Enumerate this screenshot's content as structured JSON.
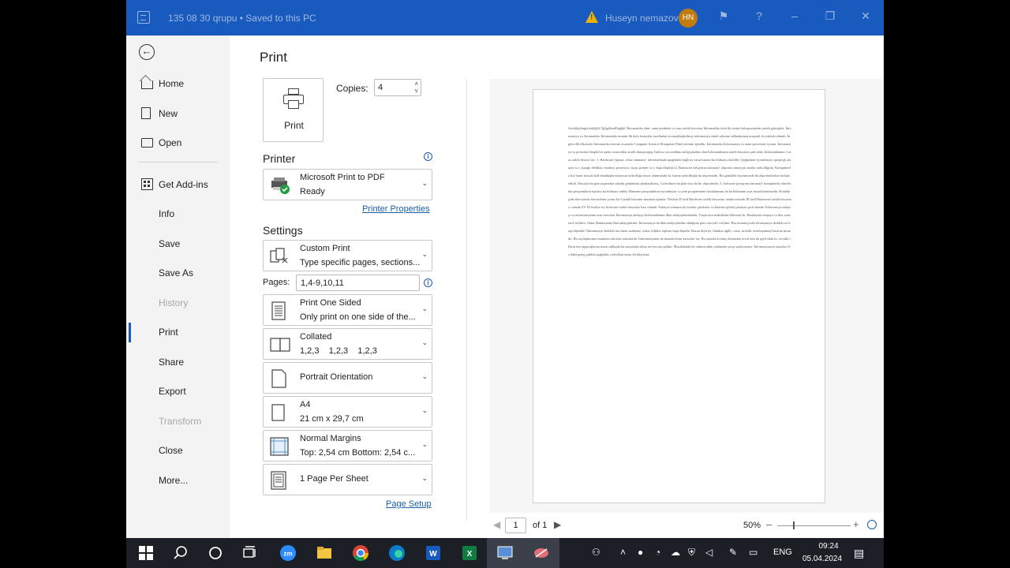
{
  "titlebar": {
    "doc_title": "135 08 30 qrupu  •  Saved to this PC",
    "user_name": "Huseyn nemazov",
    "avatar_initials": "HN",
    "accent": "#185abd"
  },
  "nav": {
    "items": [
      {
        "label": "Home",
        "icon": "home-icon"
      },
      {
        "label": "New",
        "icon": "document-icon"
      },
      {
        "label": "Open",
        "icon": "folder-icon"
      },
      {
        "label": "Get Add-ins",
        "icon": "add-ins-icon"
      },
      {
        "label": "Info"
      },
      {
        "label": "Save"
      },
      {
        "label": "Save As"
      },
      {
        "label": "History",
        "disabled": true
      },
      {
        "label": "Print",
        "selected": true
      },
      {
        "label": "Share"
      },
      {
        "label": "Export"
      },
      {
        "label": "Transform",
        "disabled": true
      },
      {
        "label": "Close"
      },
      {
        "label": "More..."
      }
    ]
  },
  "print": {
    "title": "Print",
    "print_button": "Print",
    "copies_label": "Copies:",
    "copies_value": "4"
  },
  "printer": {
    "section": "Printer",
    "name": "Microsoft Print to PDF",
    "status": "Ready",
    "properties_link": "Printer Properties"
  },
  "settings": {
    "section": "Settings",
    "range": {
      "l1": "Custom Print",
      "l2": "Type specific pages, sections..."
    },
    "pages_label": "Pages:",
    "pages_value": "1,4-9,10,11",
    "sides": {
      "l1": "Print One Sided",
      "l2": "Only print on one side of the..."
    },
    "collation": {
      "l1": "Collated",
      "l2": "1,2,3    1,2,3    1,2,3"
    },
    "orientation": {
      "l1": "Portrait Orientation"
    },
    "paper": {
      "l1": "A4",
      "l2": "21 cm x 29,7 cm"
    },
    "margins": {
      "l1": "Normal Margins",
      "l2": "Top: 2,54 cm Bottom: 2,54 c..."
    },
    "per_sheet": {
      "l1": "1 Page Per Sheet"
    },
    "page_setup_link": "Page Setup"
  },
  "preview": {
    "text": "Grtyhkjyhtrgefwdyhjkl;'/ljjhgfdsadfhghjkl;'İnformatika elmi, onun predmeti və əsas tərkib hissələri İnformatika sözü iki sözün birləşməsindən əmələ gəlmişdir: İnformasiya və Avtomatika. İnformatika termini ilk dəfə fransızlar tərəfindən avtomatlaşdırılmış informasiya emalı sahəsini adlandırmaq məqsədi ilə istifadə olunub. İngilis dili ölkələrdə İnformatika termini əvəzində Computer Science (Kompüter Elmi) termini işlədilir. İnformatika İnformasiya və onun prosesləri öyrənir. İnformasiya və prosesləri haqda bir qədər sonra daha ətraflı danışacağıq. İndi isə çox mühüm anlayışlardan olan İnformatikanın tərkib hissələri şərh edək. İnformatikanın 3 əsas tərkib hissəsi var: 1. Hardware (aparat, cihaz təminatı)- informatikada qurğularla bağlı nə varsa hamısı bu bölməyə daxildir. Qurğuların öyrənilməsi, qarşılıqlı əlaqəsi və s. (qurğu dedikdə: monitor, prosessor, siçan, printer və s. başa düşülür) 2. Brainware (alqoritm təminatı)- alqoritm müəyyən əmrlər ardıcıllığıdır. Kompüterdə hər hansı məsələ həll olunduqda müəyyən ardıcıllığa riayət olunmalıdır ki, həmin ardıcıllıqlar da alqoritmdir. Biz gündəlik həyatımızda da alqoritmlərdən istifadə edirik. Məsələn bu gün axşamdan səhərki günümüzü planlaşdırırıq. Cədvəlimiz bu plan üzrə da bir alqoritmdir. 3. Software (proqram təminatı)- kompüterdə olan bütün proqramların toplusu bu bölməyə aiddir. Hansının proqramların öyrənilməsi və yeni proqramların hazırlanması da bu bölmənin əsas məsələlərindəndir. Kitabda şərh edəcəyimiz mövzuların çoxsu bu 3 tərkib hissənin üzərində qurulur. Növbəti II fəsil Hardware tərkib hissəsinə, ondan sonrakı III fəsil Brainware tərkib hissəsinə, sonrakı IV-XI fəsillər isə Software tərkib hissəsinə həsr olunub. Nəhayət sonuncu iki fəsildə şəbəkələr və İnternet qlobal şəbəkəsi şərh olunub. İnformasiya anlayışı və informasiyanın əsas xassələri İnformasiya anlayışı İnformatikanın ilkin anlayışlarındandır. Yəqin orta məktəbdən bilirsiniz ki, Həndəsədə nöqtəyə və düz xəttə tərif verilmir. Onlar Həndəsənin ilkin anlayışlarıdır. İnformasiya da ilkin anlayışlardan olduğuna görə ona tərif verilmir. Bəs ümumiyyətlə informasiya dedikdə nə başa düşürük? İnformasiya dedikdə hər hansı məlumat, xəbər, biliklər toplusu başa düşülür. Bəzən deyirlər, filankəs ağıllı, cəsur, savadlı, dostluqətmaq bacaran insandır. Bu saydıqlarımız insanlara aid olan xassələrdir. İnformasiyanın da insanlar kimi xassələri var. Bu xassələrlə tanış olmazdan əvvəl onu da qeyd edək ki, əvvəlki illərin test tapşırıqlarına nəzər saldıqda bu xassələrin adına tez-tez rast gəlinir. Məsələhətdir ki onların adını yadınızda yaxşı saxlayasınız. İnformasiyanın xassələri ilə daha geniş şəkildə aşağıdakı cədvəldən tanış ola bilərsiniz",
    "page_current": "1",
    "page_of": "of 1",
    "zoom": "50%"
  },
  "taskbar": {
    "lang": "ENG",
    "time": "09:24",
    "date": "05.04.2024"
  }
}
